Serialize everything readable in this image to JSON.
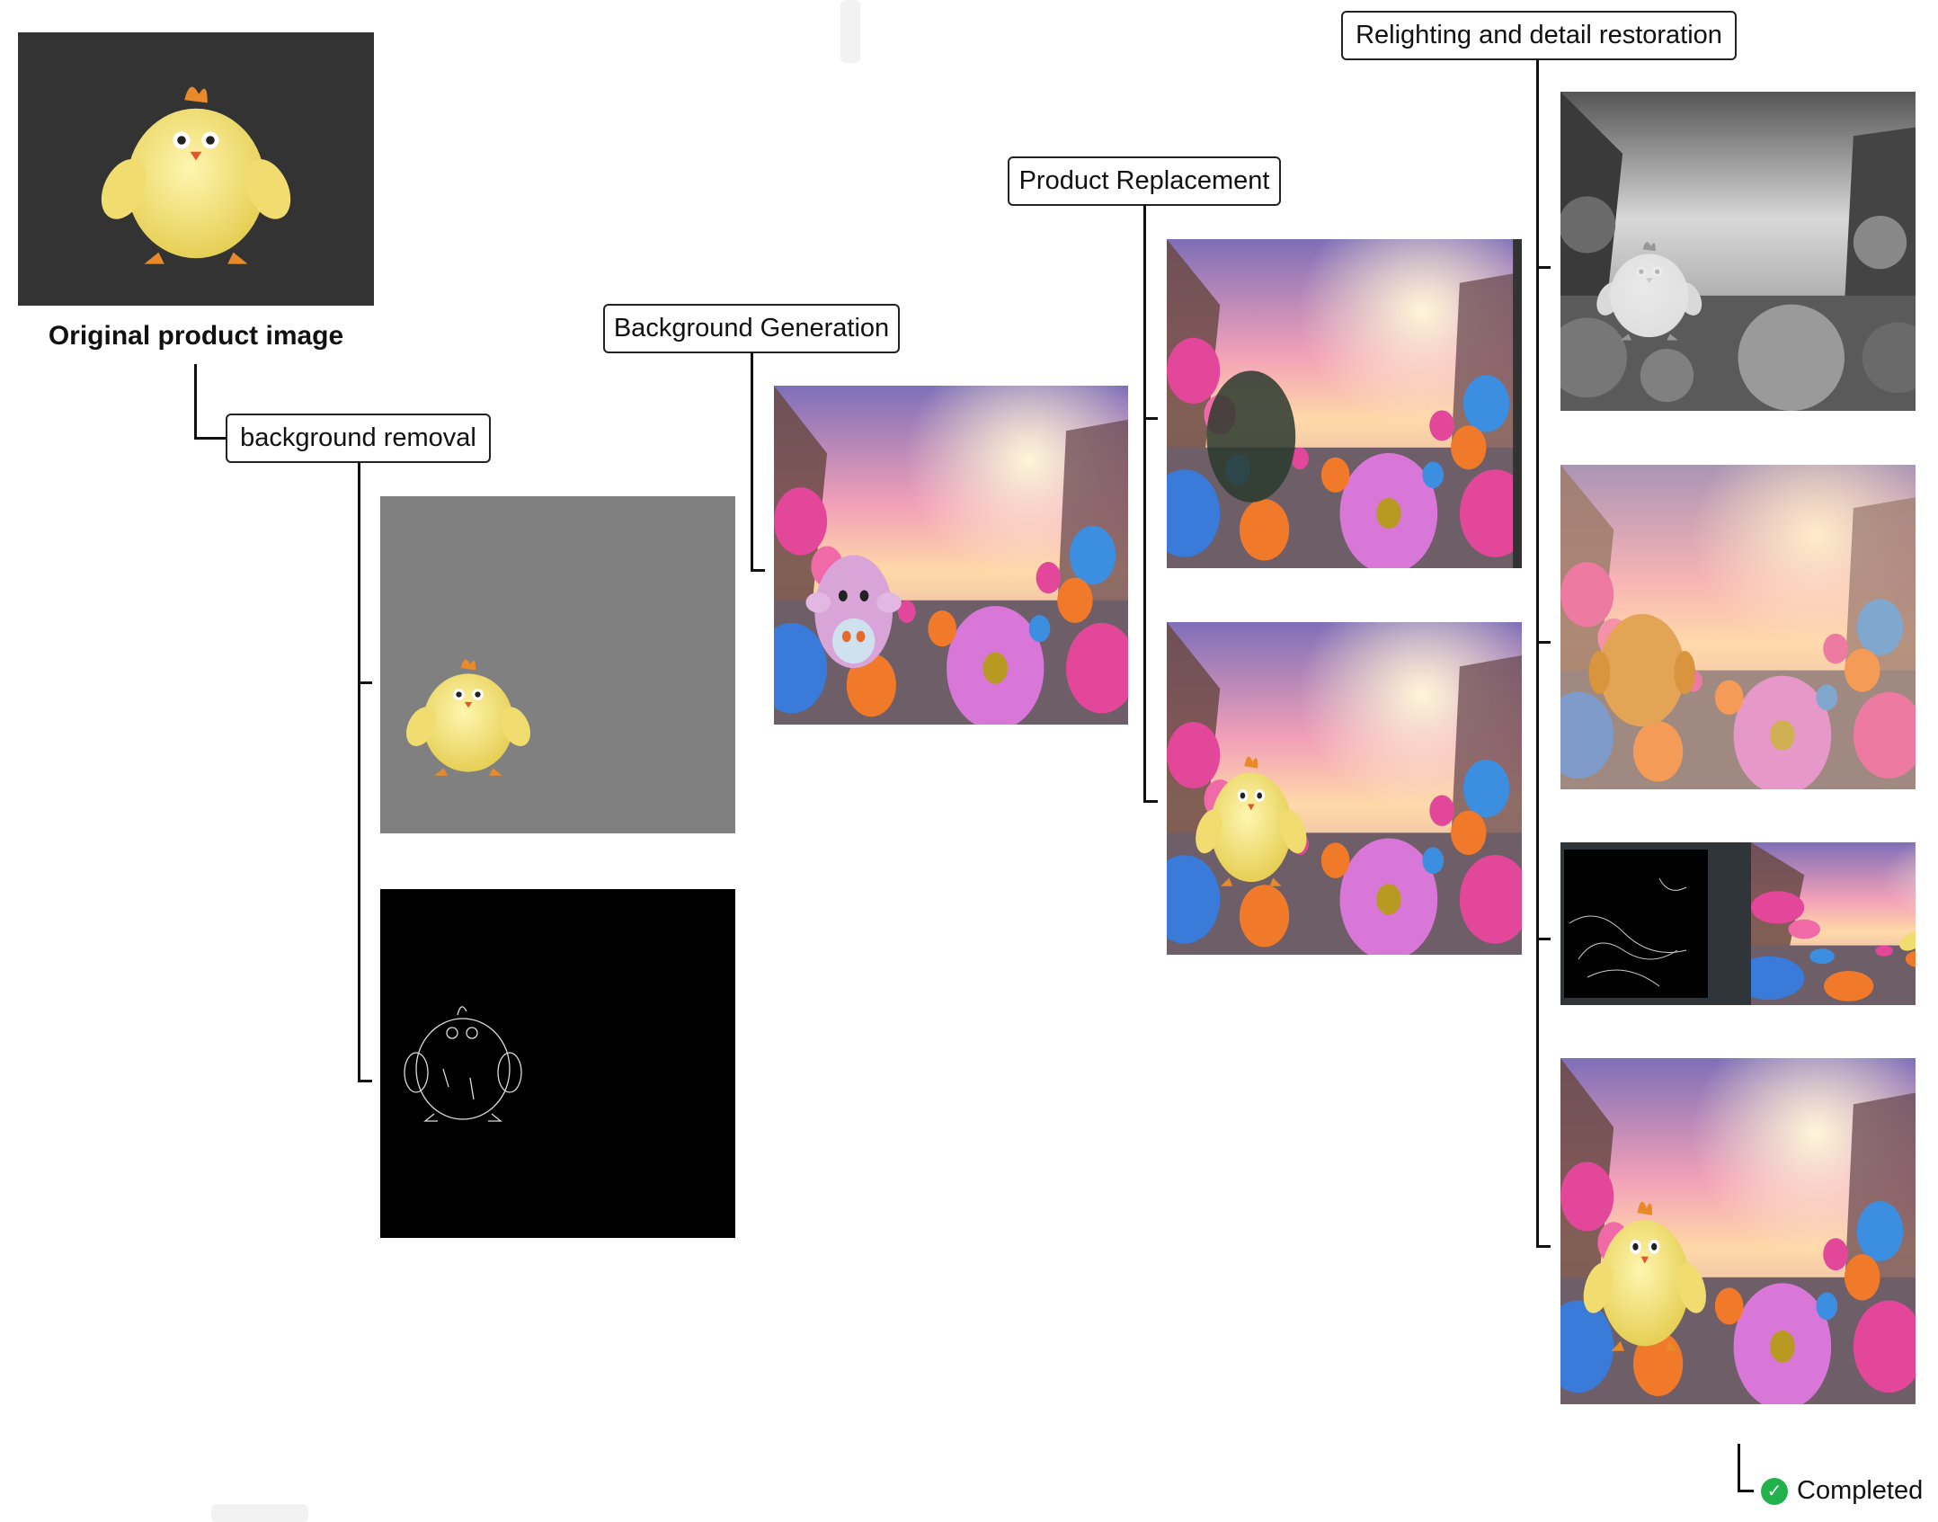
{
  "original": {
    "caption": "Original product image"
  },
  "stages": {
    "background_removal": "background removal",
    "background_generation": "Background Generation",
    "product_replacement": "Product Replacement",
    "relighting": "Relighting and detail restoration"
  },
  "status": {
    "label": "Completed",
    "icon": "check-circle-icon"
  },
  "colors": {
    "line": "#111111",
    "success": "#22b24c",
    "mask_bg": "#808080",
    "product_bg": "#333333"
  }
}
